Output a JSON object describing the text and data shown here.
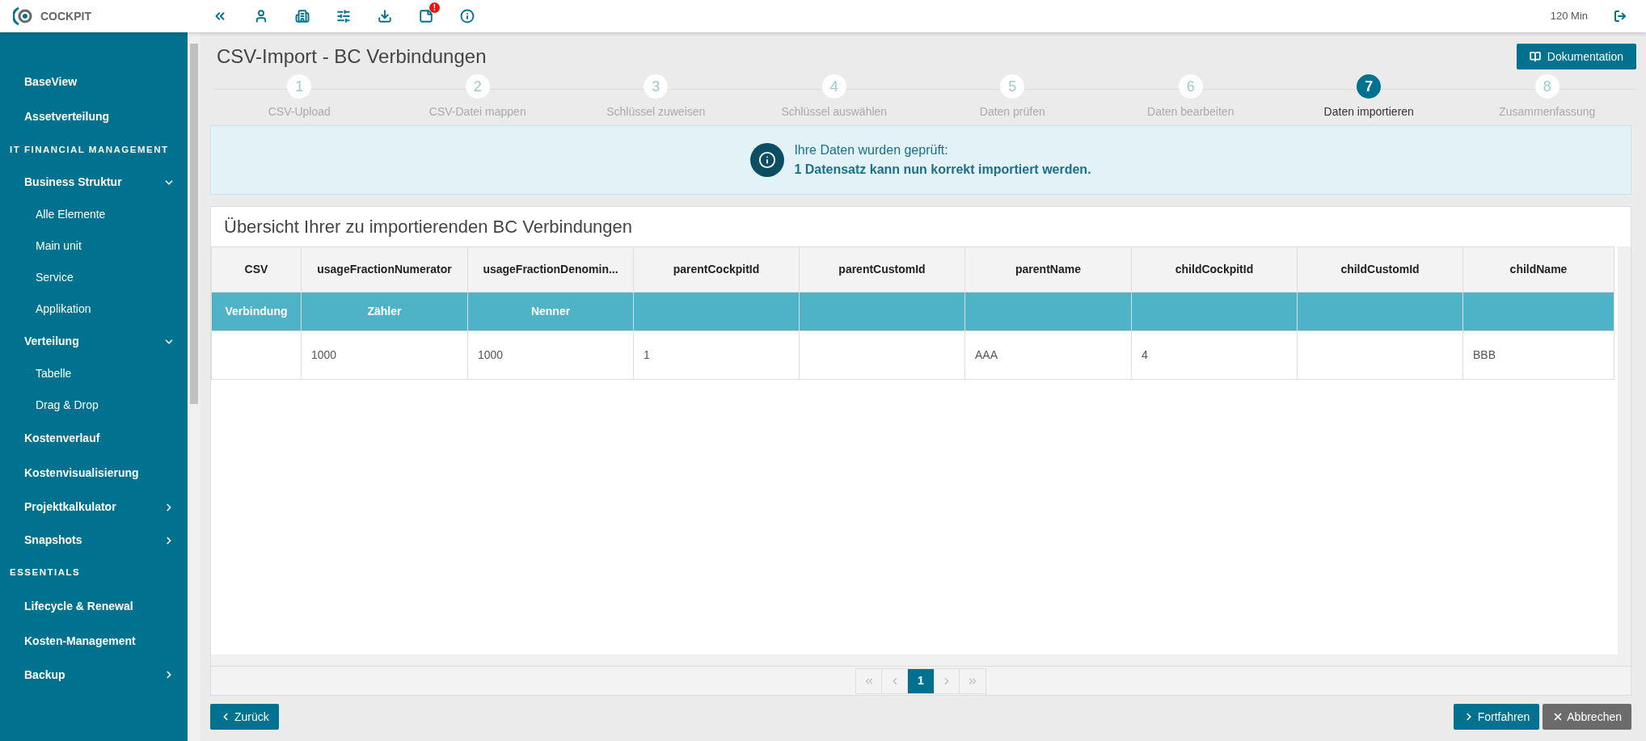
{
  "topbar": {
    "logo_text": "COCKPIT",
    "notification_badge": "!",
    "session": "120 Min"
  },
  "sidebar": {
    "items": [
      {
        "kind": "link",
        "label": "BaseView"
      },
      {
        "kind": "link",
        "label": "Assetverteilung"
      },
      {
        "kind": "section",
        "label": "IT FINANCIAL MANAGEMENT"
      },
      {
        "kind": "group",
        "label": "Business Struktur",
        "expanded": true,
        "children": [
          {
            "label": "Alle Elemente"
          },
          {
            "label": "Main unit"
          },
          {
            "label": "Service"
          },
          {
            "label": "Applikation"
          }
        ]
      },
      {
        "kind": "group",
        "label": "Verteilung",
        "expanded": true,
        "children": [
          {
            "label": "Tabelle"
          },
          {
            "label": "Drag & Drop"
          }
        ]
      },
      {
        "kind": "link",
        "label": "Kostenverlauf"
      },
      {
        "kind": "link",
        "label": "Kostenvisualisierung"
      },
      {
        "kind": "group",
        "label": "Projektkalkulator",
        "expanded": false
      },
      {
        "kind": "group",
        "label": "Snapshots",
        "expanded": false
      },
      {
        "kind": "section",
        "label": "ESSENTIALS"
      },
      {
        "kind": "link",
        "label": "Lifecycle & Renewal"
      },
      {
        "kind": "link",
        "label": "Kosten-Management"
      },
      {
        "kind": "group",
        "label": "Backup",
        "expanded": false
      }
    ]
  },
  "page": {
    "title": "CSV-Import - BC Verbindungen",
    "doc_button": "Dokumentation"
  },
  "steps": [
    {
      "number": "1",
      "label": "CSV-Upload",
      "selected": false
    },
    {
      "number": "2",
      "label": "CSV-Datei mappen",
      "selected": false
    },
    {
      "number": "3",
      "label": "Schlüssel zuweisen",
      "selected": false
    },
    {
      "number": "4",
      "label": "Schlüssel auswählen",
      "selected": false
    },
    {
      "number": "5",
      "label": "Daten prüfen",
      "selected": false
    },
    {
      "number": "6",
      "label": "Daten bearbeiten",
      "selected": false
    },
    {
      "number": "7",
      "label": "Daten importieren",
      "selected": true
    },
    {
      "number": "8",
      "label": "Zusammenfassung",
      "selected": false
    }
  ],
  "alert": {
    "message": "Ihre Daten wurden geprüft:",
    "detail": "1 Datensatz kann nun korrekt importiert werden."
  },
  "table": {
    "title": "Übersicht Ihrer zu importierenden BC Verbindungen",
    "columns": [
      "CSV",
      "usageFractionNumerator",
      "usageFractionDenomin...",
      "parentCockpitId",
      "parentCustomId",
      "parentName",
      "childCockpitId",
      "childCustomId",
      "childName"
    ],
    "mapping": [
      "Verbindung",
      "Zähler",
      "Nenner"
    ],
    "rows": [
      [
        "",
        "1000",
        "1000",
        "1",
        "",
        "AAA",
        "4",
        "",
        "BBB"
      ]
    ]
  },
  "pagination": {
    "pages": [
      {
        "label": "1",
        "selected": true
      }
    ]
  },
  "buttons": [
    {
      "kind": "back",
      "label": "Zurück"
    },
    {
      "kind": "next",
      "label": "Fortfahren"
    },
    {
      "kind": "cancel",
      "label": "Abbrechen"
    }
  ]
}
